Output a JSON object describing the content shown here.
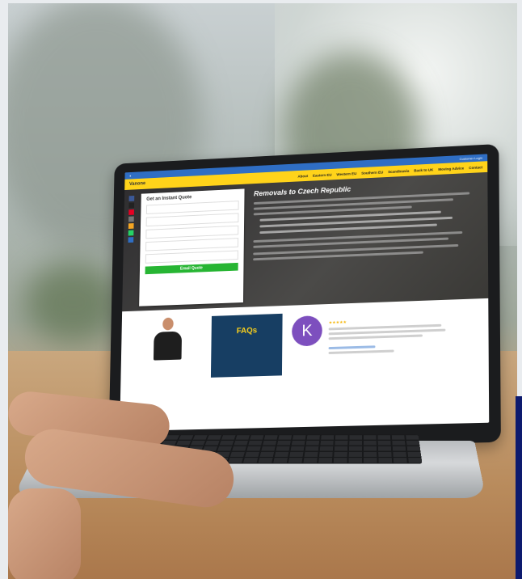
{
  "site": {
    "logo": "Vanone",
    "nav": [
      "About",
      "Eastern EU",
      "Western EU",
      "Southern EU",
      "Scandinavia",
      "Back to UK",
      "Moving Advice",
      "Contact"
    ],
    "top_right": "Customer Login"
  },
  "quote_form": {
    "title": "Get an Instant Quote",
    "button": "Email Quote"
  },
  "hero": {
    "title": "Removals to Czech Republic"
  },
  "faq": {
    "title": "FAQs"
  },
  "review": {
    "avatar_letter": "K",
    "stars": "★★★★★"
  },
  "colors": {
    "nav_yellow": "#ffd31a",
    "top_blue": "#2f6ec4",
    "cta_green": "#27b533",
    "faq_navy": "#173e63",
    "avatar_purple": "#7d4fbe"
  }
}
